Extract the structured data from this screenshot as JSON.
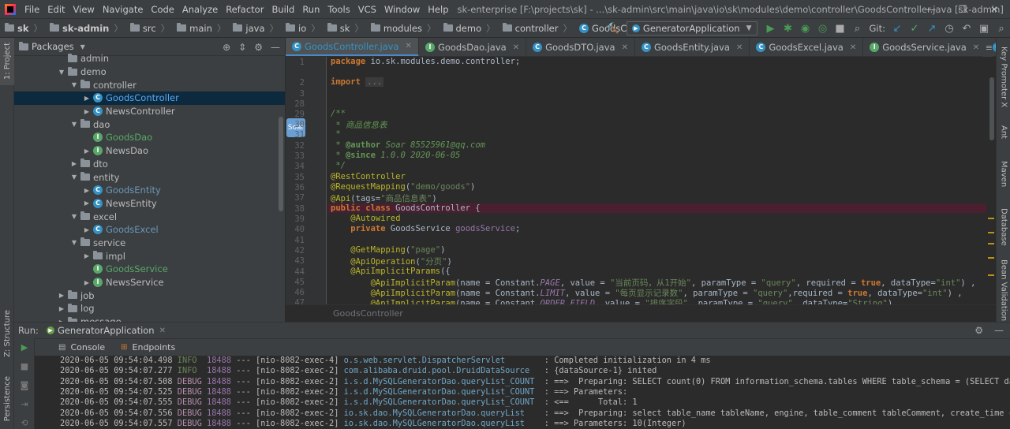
{
  "window": {
    "menu": [
      "File",
      "Edit",
      "View",
      "Navigate",
      "Code",
      "Analyze",
      "Refactor",
      "Build",
      "Run",
      "Tools",
      "VCS",
      "Window",
      "Help"
    ],
    "title": "sk-enterprise [F:\\projects\\sk] - ...\\sk-admin\\src\\main\\java\\io\\sk\\modules\\demo\\controller\\GoodsController.java [sk-admin]",
    "controls": [
      "—",
      "❐",
      "✕"
    ]
  },
  "navbar": {
    "crumbs": [
      "sk",
      "sk-admin",
      "src",
      "main",
      "java",
      "io",
      "sk",
      "modules",
      "demo",
      "controller",
      "GoodsController"
    ],
    "run_config": "GeneratorApplication",
    "git_label": "Git:"
  },
  "left_strip": {
    "project_tab": "1: Project",
    "structure_tab": "Z: Structure",
    "persistence_tab": "Persistence"
  },
  "right_strip": {
    "tabs": [
      "Key Promoter X",
      "Ant",
      "Maven",
      "Database",
      "Bean Validation"
    ]
  },
  "project_panel": {
    "view_mode": "Packages",
    "tree": [
      {
        "label": "admin",
        "indent": 4,
        "arrow": "",
        "kind": "folder"
      },
      {
        "label": "demo",
        "indent": 4,
        "arrow": "▼",
        "kind": "folder"
      },
      {
        "label": "controller",
        "indent": 5,
        "arrow": "▼",
        "kind": "folder"
      },
      {
        "label": "GoodsController",
        "indent": 6,
        "arrow": "▶",
        "kind": "class",
        "selected": true
      },
      {
        "label": "NewsController",
        "indent": 6,
        "arrow": "▶",
        "kind": "class"
      },
      {
        "label": "dao",
        "indent": 5,
        "arrow": "▼",
        "kind": "folder"
      },
      {
        "label": "GoodsDao",
        "indent": 6,
        "arrow": "",
        "kind": "iface",
        "green": true
      },
      {
        "label": "NewsDao",
        "indent": 6,
        "arrow": "▶",
        "kind": "iface"
      },
      {
        "label": "dto",
        "indent": 5,
        "arrow": "▶",
        "kind": "folder"
      },
      {
        "label": "entity",
        "indent": 5,
        "arrow": "▼",
        "kind": "folder"
      },
      {
        "label": "GoodsEntity",
        "indent": 6,
        "arrow": "▶",
        "kind": "class",
        "blue": true
      },
      {
        "label": "NewsEntity",
        "indent": 6,
        "arrow": "▶",
        "kind": "class"
      },
      {
        "label": "excel",
        "indent": 5,
        "arrow": "▼",
        "kind": "folder"
      },
      {
        "label": "GoodsExcel",
        "indent": 6,
        "arrow": "▶",
        "kind": "class",
        "blue": true
      },
      {
        "label": "service",
        "indent": 5,
        "arrow": "▼",
        "kind": "folder"
      },
      {
        "label": "impl",
        "indent": 6,
        "arrow": "▶",
        "kind": "folder"
      },
      {
        "label": "GoodsService",
        "indent": 6,
        "arrow": "",
        "kind": "iface",
        "green": true
      },
      {
        "label": "NewsService",
        "indent": 6,
        "arrow": "▶",
        "kind": "iface"
      },
      {
        "label": "job",
        "indent": 4,
        "arrow": "▶",
        "kind": "folder"
      },
      {
        "label": "log",
        "indent": 4,
        "arrow": "▶",
        "kind": "folder"
      },
      {
        "label": "message",
        "indent": 4,
        "arrow": "▶",
        "kind": "folder"
      }
    ]
  },
  "editor": {
    "tabs": [
      {
        "label": "GoodsController.java",
        "active": true,
        "kind": "class"
      },
      {
        "label": "GoodsDao.java",
        "kind": "iface"
      },
      {
        "label": "GoodsDTO.java",
        "kind": "class"
      },
      {
        "label": "GoodsEntity.java",
        "kind": "class"
      },
      {
        "label": "GoodsExcel.java",
        "kind": "class"
      },
      {
        "label": "GoodsService.java",
        "kind": "iface"
      },
      {
        "label": "GoodsServiceI",
        "kind": "class"
      }
    ],
    "more_tabs": "≡",
    "line_numbers": [
      "1",
      "2",
      "3",
      "28",
      "29",
      "30",
      "31",
      "32",
      "33",
      "34",
      "35",
      "36",
      "37",
      "38",
      "39",
      "40",
      "41",
      "42",
      "43",
      "44",
      "45",
      "46",
      "47",
      "48"
    ],
    "breadcrumb": "GoodsController",
    "avatar_label": "Soar"
  },
  "run_panel": {
    "label": "Run:",
    "tab": "GeneratorApplication",
    "subtabs": [
      "Console",
      "Endpoints"
    ],
    "logs": [
      {
        "ts": "2020-06-05 09:54:04.498",
        "level": "INFO",
        "pid": "18488",
        "thread": "[nio-8082-exec-4]",
        "logger": "o.s.web.servlet.DispatcherServlet",
        "msg": ": Completed initialization in 4 ms"
      },
      {
        "ts": "2020-06-05 09:54:07.277",
        "level": "INFO",
        "pid": "18488",
        "thread": "[nio-8082-exec-2]",
        "logger": "com.alibaba.druid.pool.DruidDataSource",
        "msg": ": {dataSource-1} inited"
      },
      {
        "ts": "2020-06-05 09:54:07.508",
        "level": "DEBUG",
        "pid": "18488",
        "thread": "[nio-8082-exec-2]",
        "logger": "i.s.d.MySQLGeneratorDao.queryList_COUNT",
        "msg": ": ==>  Preparing: SELECT count(0) FROM information_schema.tables WHERE table_schema = (SELECT datab"
      },
      {
        "ts": "2020-06-05 09:54:07.525",
        "level": "DEBUG",
        "pid": "18488",
        "thread": "[nio-8082-exec-2]",
        "logger": "i.s.d.MySQLGeneratorDao.queryList_COUNT",
        "msg": ": ==> Parameters:"
      },
      {
        "ts": "2020-06-05 09:54:07.555",
        "level": "DEBUG",
        "pid": "18488",
        "thread": "[nio-8082-exec-2]",
        "logger": "i.s.d.MySQLGeneratorDao.queryList_COUNT",
        "msg": ": <==      Total: 1"
      },
      {
        "ts": "2020-06-05 09:54:07.556",
        "level": "DEBUG",
        "pid": "18488",
        "thread": "[nio-8082-exec-2]",
        "logger": "io.sk.dao.MySQLGeneratorDao.queryList",
        "msg": ": ==>  Preparing: select table_name tableName, engine, table_comment tableComment, create_time crea"
      },
      {
        "ts": "2020-06-05 09:54:07.557",
        "level": "DEBUG",
        "pid": "18488",
        "thread": "[nio-8082-exec-2]",
        "logger": "io.sk.dao.MySQLGeneratorDao.queryList",
        "msg": ": ==> Parameters: 10(Integer)"
      }
    ]
  },
  "colors": {
    "accent": "#3592c4",
    "selection": "#0d293e",
    "breakpoint_line": "#4a2030",
    "run_green": "#499c54"
  }
}
